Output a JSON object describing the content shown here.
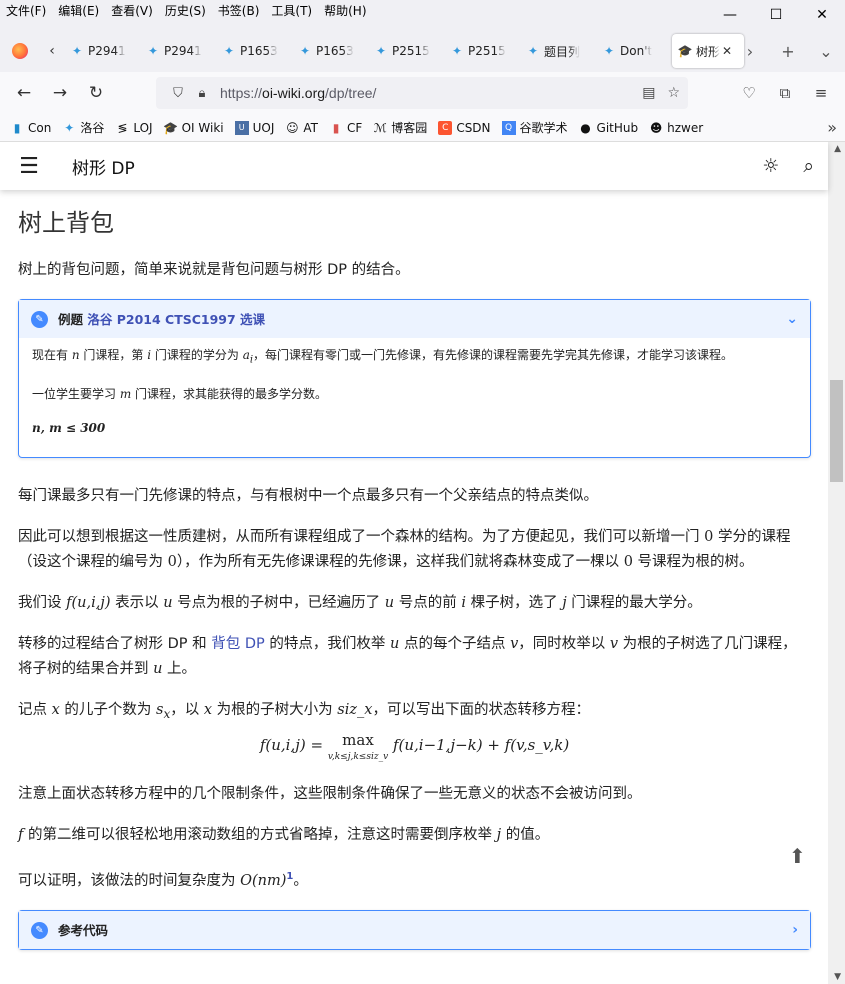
{
  "menubar": [
    "文件(F)",
    "编辑(E)",
    "查看(V)",
    "历史(S)",
    "书签(B)",
    "工具(T)",
    "帮助(H)"
  ],
  "window": {
    "minimize": "—",
    "maximize": "☐",
    "close": "✕"
  },
  "tabs": [
    {
      "title": "P2941",
      "icon": "luogu-icon"
    },
    {
      "title": "P2941",
      "icon": "luogu-icon"
    },
    {
      "title": "P1653",
      "icon": "luogu-icon"
    },
    {
      "title": "P1653",
      "icon": "luogu-icon"
    },
    {
      "title": "P2515",
      "icon": "luogu-icon"
    },
    {
      "title": "P2515",
      "icon": "luogu-icon"
    },
    {
      "title": "题目列",
      "icon": "luogu-icon"
    },
    {
      "title": "Don't",
      "icon": "luogu-icon"
    },
    {
      "title": "树形",
      "icon": "oiwiki-icon",
      "active": true
    }
  ],
  "url": {
    "prefix": "https://",
    "domain": "oi-wiki.org",
    "path": "/dp/tree/"
  },
  "bookmarks": [
    {
      "label": "Con",
      "icon": "codeforces-icon"
    },
    {
      "label": "洛谷",
      "icon": "luogu-icon"
    },
    {
      "label": "LOJ",
      "icon": "loj-icon"
    },
    {
      "label": "OI Wiki",
      "icon": "oiwiki-icon"
    },
    {
      "label": "UOJ",
      "icon": "uoj-icon"
    },
    {
      "label": "AT",
      "icon": "atcoder-icon"
    },
    {
      "label": "CF",
      "icon": "cf-icon"
    },
    {
      "label": "博客园",
      "icon": "cnblogs-icon"
    },
    {
      "label": "CSDN",
      "icon": "csdn-icon"
    },
    {
      "label": "谷歌学术",
      "icon": "scholar-icon"
    },
    {
      "label": "GitHub",
      "icon": "github-icon"
    },
    {
      "label": "hzwer",
      "icon": "hzwer-icon"
    }
  ],
  "header": {
    "title": "树形 DP"
  },
  "content": {
    "heading": "树上背包",
    "intro": "树上的背包问题，简单来说就是背包问题与树形 DP 的结合。",
    "example": {
      "label": "例题",
      "link": "洛谷 P2014 CTSC1997 选课",
      "p1a": "现在有 ",
      "p1b": " 门课程，第 ",
      "p1c": " 门课程的学分为 ",
      "p1d": "，每门课程有零门或一门先修课，有先修课的课程需要先学完其先修课，才能学习该课程。",
      "p2a": "一位学生要学习 ",
      "p2b": " 门课程，求其能获得的最多学分数。",
      "constraint": "n, m ≤ 300"
    },
    "p1": "每门课最多只有一门先修课的特点，与有根树中一个点最多只有一个父亲结点的特点类似。",
    "p2a": "因此可以想到根据这一性质建树，从而所有课程组成了一个森林的结构。为了方便起见，我们可以新增一门 ",
    "p2b": " 学分的课程（设这个课程的编号为 ",
    "p2c": "），作为所有无先修课课程的先修课，这样我们就将森林变成了一棵以 ",
    "p2d": " 号课程为根的树。",
    "p3a": "我们设 ",
    "p3b": " 表示以 ",
    "p3c": " 号点为根的子树中，已经遍历了 ",
    "p3d": " 号点的前 ",
    "p3e": " 棵子树，选了 ",
    "p3f": " 门课程的最大学分。",
    "p4a": "转移的过程结合了树形 DP 和 ",
    "p4link": "背包 DP",
    "p4b": " 的特点，我们枚举 ",
    "p4c": " 点的每个子结点 ",
    "p4d": "，同时枚举以 ",
    "p4e": " 为根的子树选了几门课程，将子树的结果合并到 ",
    "p4f": " 上。",
    "p5a": "记点 ",
    "p5b": " 的儿子个数为 ",
    "p5c": "，以 ",
    "p5d": " 为根的子树大小为 ",
    "p5e": "，可以写出下面的状态转移方程：",
    "formula_left": "f(u,i,j) = ",
    "formula_max": "max",
    "formula_sub": "v,k≤j,k≤siz_v",
    "formula_right": " f(u,i−1,j−k) + f(v,s_v,k)",
    "p6": "注意上面状态转移方程中的几个限制条件，这些限制条件确保了一些无意义的状态不会被访问到。",
    "p7a": " 的第二维可以很轻松地用滚动数组的方式省略掉，注意这时需要倒序枚举 ",
    "p7b": " 的值。",
    "p8a": "可以证明，该做法的时间复杂度为 ",
    "p8b": "O(nm)",
    "p8sup": "1",
    "p8c": "。",
    "code": "参考代码",
    "m": {
      "n": "n",
      "i": "i",
      "ai": "a",
      "ai_sub": "i",
      "m": "m",
      "zero": "0",
      "f": "f(u,i,j)",
      "u": "u",
      "j": "j",
      "v": "v",
      "x": "x",
      "sx": "s",
      "sx_sub": "x",
      "siz": "siz_x",
      "fvar": "f"
    }
  }
}
